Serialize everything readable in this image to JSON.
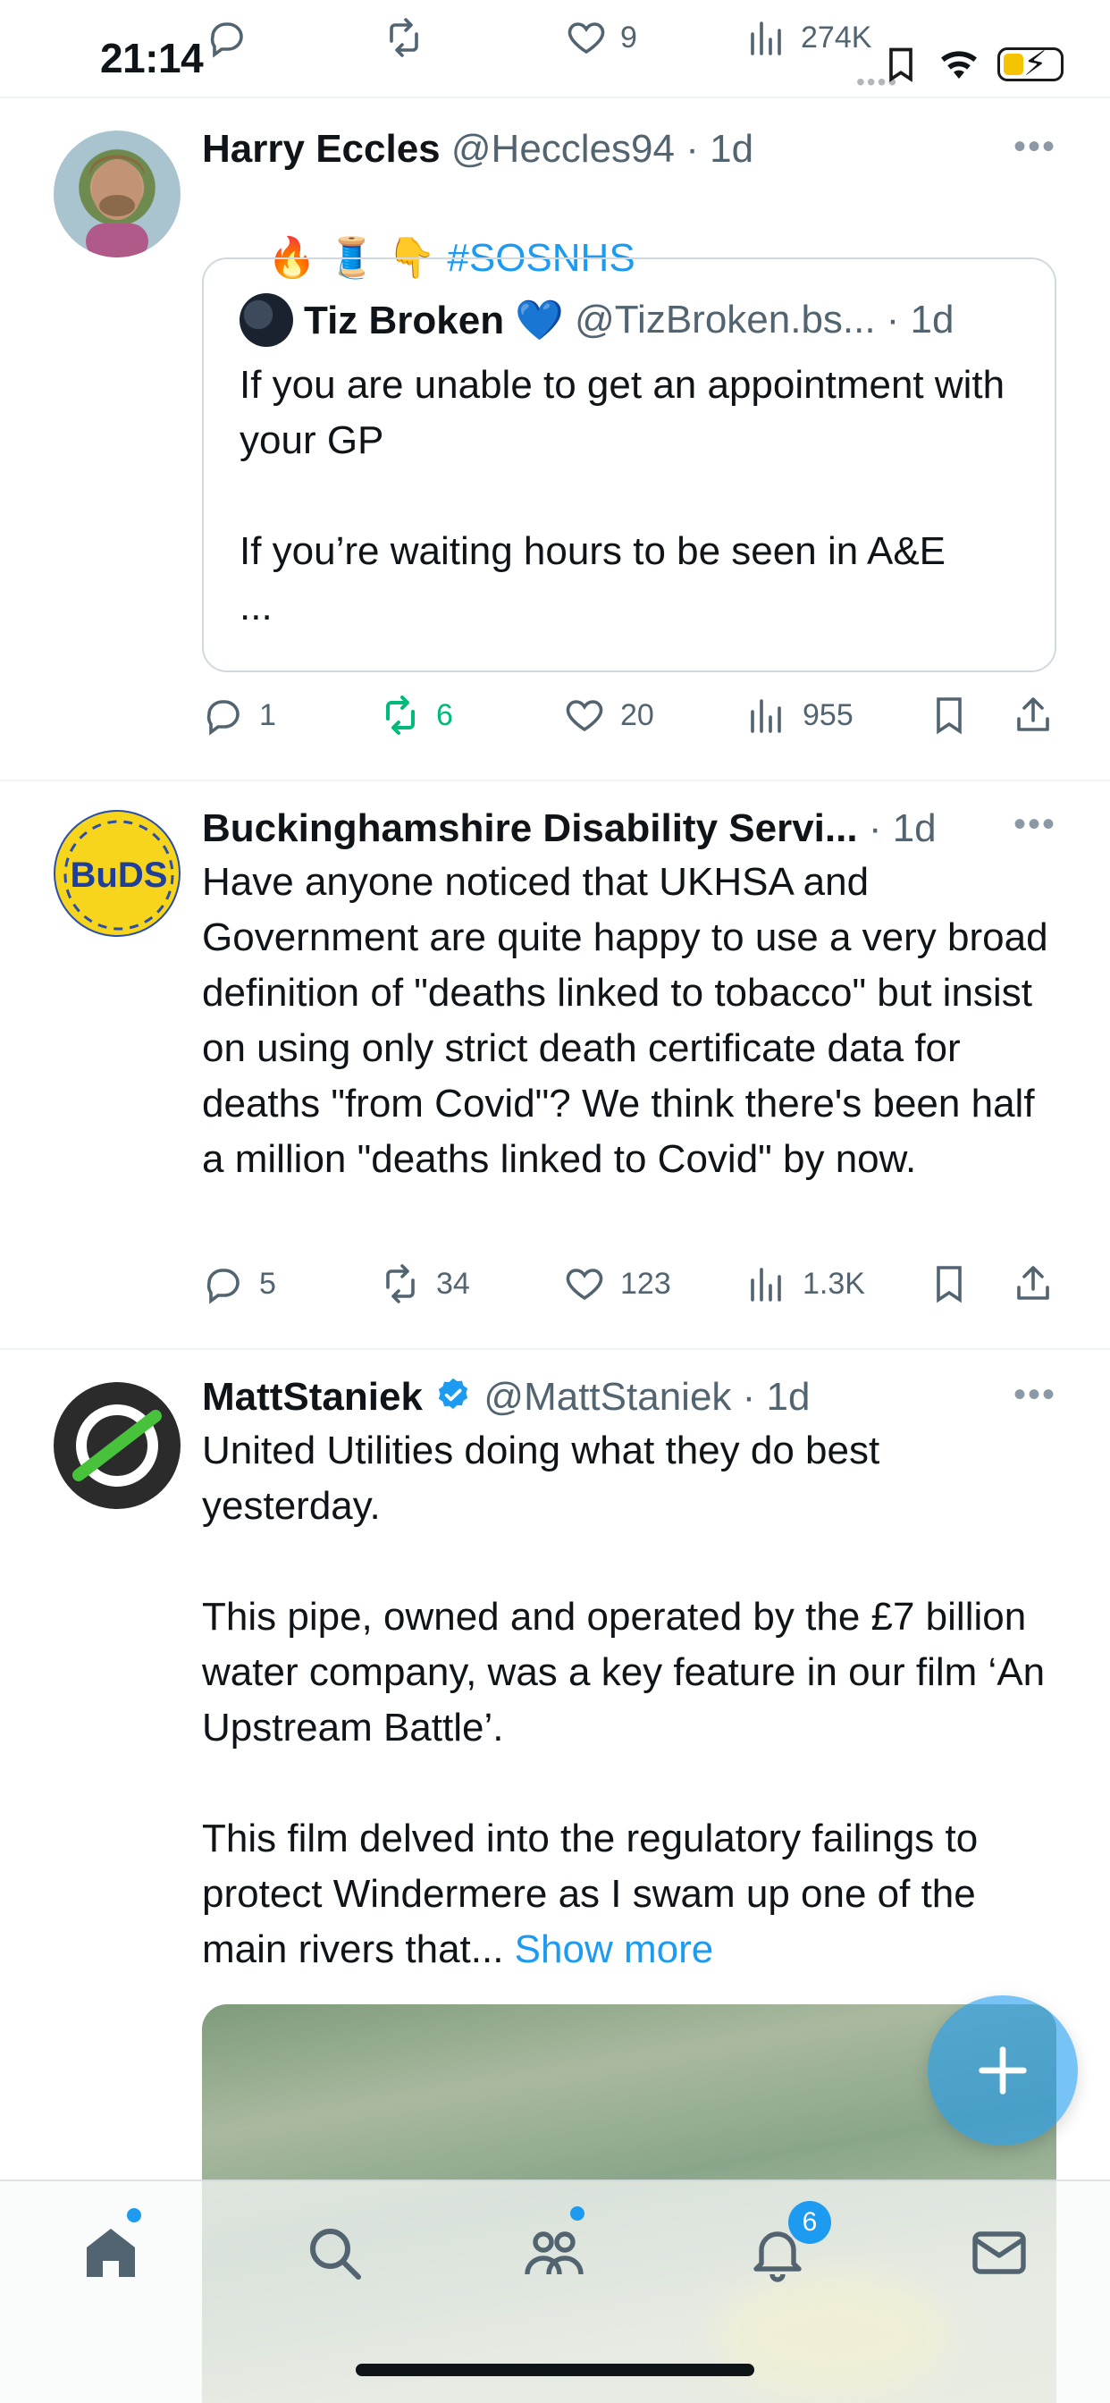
{
  "status_bar": {
    "time": "21:14"
  },
  "top_actions": {
    "reply_count": "",
    "retweet_count": "",
    "like_count": "9",
    "views_count": "274K"
  },
  "tweets": [
    {
      "display_name": "Harry Eccles",
      "handle": "@Heccles94",
      "time": "· 1d",
      "emoji_text": "🔥 🧵 👇 ",
      "hashtag": "#SOSNHS",
      "quote": {
        "display_name": "Tiz Broken 💙",
        "handle": "@TizBroken.bs...",
        "time": "· 1d",
        "text": "If you are unable to get an appointment with your GP\n\nIf you’re waiting hours to be seen in A&E\n..."
      },
      "replies": "1",
      "retweets": "6",
      "likes": "20",
      "views": "955"
    },
    {
      "display_name": "Buckinghamshire Disability Servi...",
      "handle": "",
      "time": "· 1d",
      "avatar_text": "BuDS",
      "text": "Have anyone noticed that UKHSA and Government are quite happy to use a very broad definition of \"deaths linked to tobacco\" but insist on using only strict death certificate data for deaths \"from Covid\"? We think there's been half a million \"deaths linked to Covid\" by now.",
      "replies": "5",
      "retweets": "34",
      "likes": "123",
      "views": "1.3K"
    },
    {
      "display_name": "MattStaniek",
      "handle": "@MattStaniek",
      "time": "· 1d",
      "text": "United Utilities doing what they do best yesterday.\n\nThis pipe, owned and operated by the £7 billion water company, was a key feature in our film ‘An Upstream Battle’.\n\nThis film delved into the regulatory failings to protect Windermere as I swam up one of the main rivers that... ",
      "show_more": "Show more"
    }
  ],
  "tab_bar": {
    "notifications_badge": "6"
  },
  "colors": {
    "accent": "#1d9bf0",
    "retweet_green": "#00ba7c",
    "secondary_text": "#536471"
  }
}
